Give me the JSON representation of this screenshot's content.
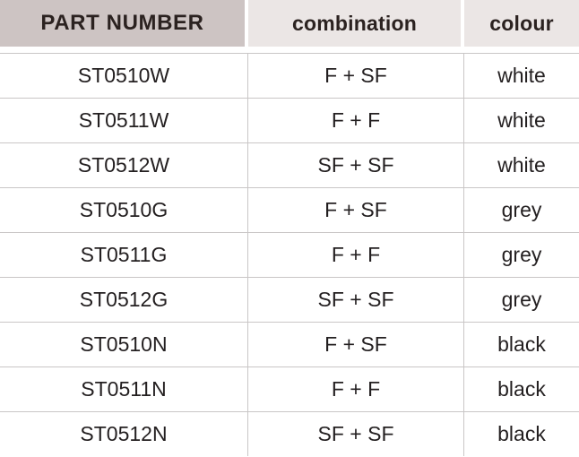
{
  "table": {
    "columns": [
      {
        "key": "part_number",
        "label": "PART NUMBER"
      },
      {
        "key": "combination",
        "label": "combination"
      },
      {
        "key": "colour",
        "label": "colour"
      }
    ],
    "header_styles": {
      "part_number_background": "#cdc4c3",
      "combination_background": "#ebe6e5",
      "colour_background": "#ebe6e5",
      "header_text_color": "#2b2220"
    },
    "body_styles": {
      "row_background": "#ffffff",
      "rule_color": "#c9c6c6",
      "body_text_color": "#231f20"
    },
    "rows": [
      {
        "part_number": "ST0510W",
        "combination": "F + SF",
        "colour": "white"
      },
      {
        "part_number": "ST0511W",
        "combination": "F + F",
        "colour": "white"
      },
      {
        "part_number": "ST0512W",
        "combination": "SF + SF",
        "colour": "white"
      },
      {
        "part_number": "ST0510G",
        "combination": "F + SF",
        "colour": "grey"
      },
      {
        "part_number": "ST0511G",
        "combination": "F + F",
        "colour": "grey"
      },
      {
        "part_number": "ST0512G",
        "combination": "SF + SF",
        "colour": "grey"
      },
      {
        "part_number": "ST0510N",
        "combination": "F + SF",
        "colour": "black"
      },
      {
        "part_number": "ST0511N",
        "combination": "F + F",
        "colour": "black"
      },
      {
        "part_number": "ST0512N",
        "combination": "SF + SF",
        "colour": "black"
      }
    ]
  }
}
